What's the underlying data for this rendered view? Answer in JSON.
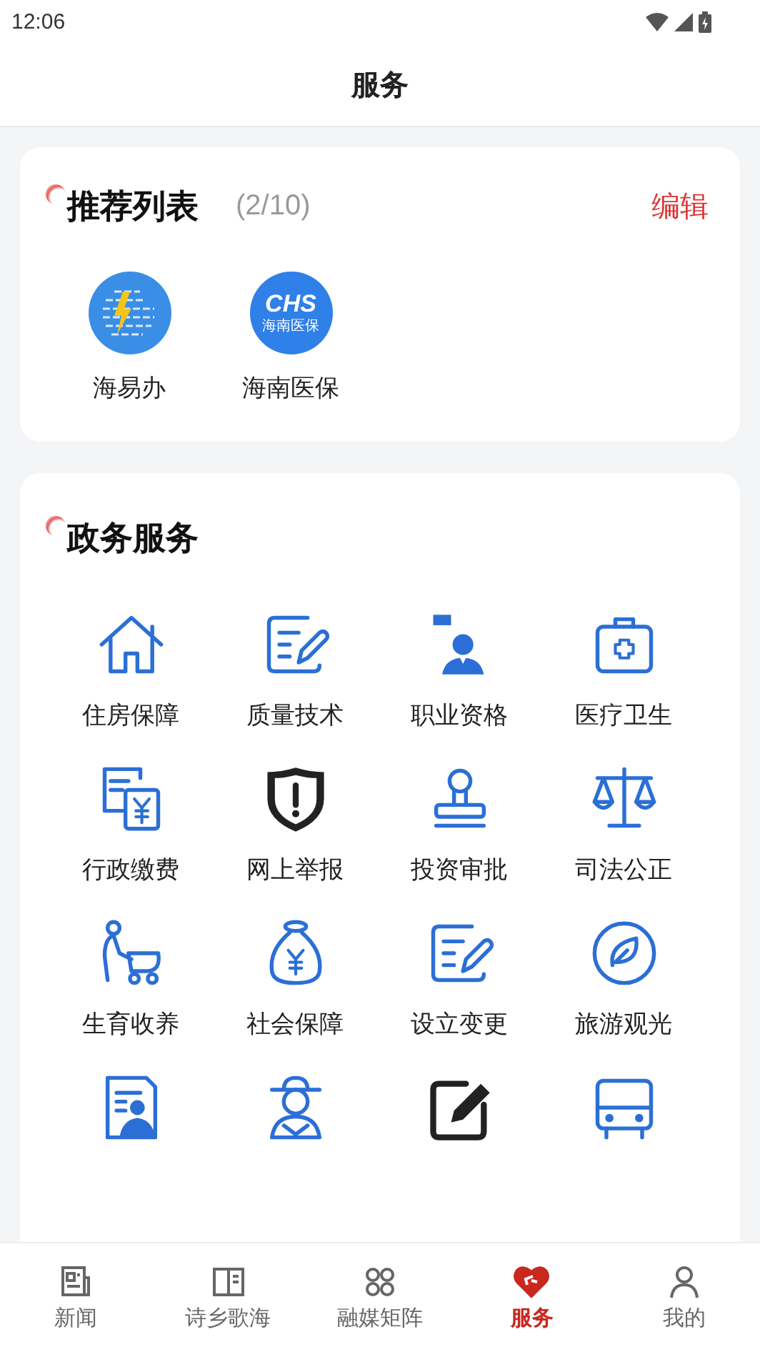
{
  "status_bar": {
    "time": "12:06"
  },
  "header": {
    "title": "服务"
  },
  "recommended": {
    "title": "推荐列表",
    "count": "(2/10)",
    "action": "编辑",
    "apps": [
      {
        "label": "海易办",
        "kind": "bolt-globe"
      },
      {
        "label": "海南医保",
        "kind": "chs",
        "logo_mark": "CHS",
        "logo_caption": "海南医保"
      }
    ]
  },
  "services": {
    "title": "政务服务",
    "items": [
      {
        "label": "住房保障",
        "kind": "house"
      },
      {
        "label": "质量技术",
        "kind": "form"
      },
      {
        "label": "职业资格",
        "kind": "worker"
      },
      {
        "label": "医疗卫生",
        "kind": "medkit"
      },
      {
        "label": "行政缴费",
        "kind": "bill"
      },
      {
        "label": "网上举报",
        "kind": "shield"
      },
      {
        "label": "投资审批",
        "kind": "stamp"
      },
      {
        "label": "司法公正",
        "kind": "scales"
      },
      {
        "label": "生育收养",
        "kind": "stroller"
      },
      {
        "label": "社会保障",
        "kind": "moneybag"
      },
      {
        "label": "设立变更",
        "kind": "form"
      },
      {
        "label": "旅游观光",
        "kind": "leaf"
      },
      {
        "kind": "idcard"
      },
      {
        "kind": "hat"
      },
      {
        "kind": "edit"
      },
      {
        "kind": "bus"
      }
    ]
  },
  "tab_bar": [
    {
      "label": "新闻",
      "kind": "news",
      "selected": false
    },
    {
      "label": "诗乡歌海",
      "kind": "book",
      "selected": false
    },
    {
      "label": "融媒矩阵",
      "kind": "grid",
      "selected": false
    },
    {
      "label": "服务",
      "kind": "heart",
      "selected": true
    },
    {
      "label": "我的",
      "kind": "person",
      "selected": false
    }
  ]
}
